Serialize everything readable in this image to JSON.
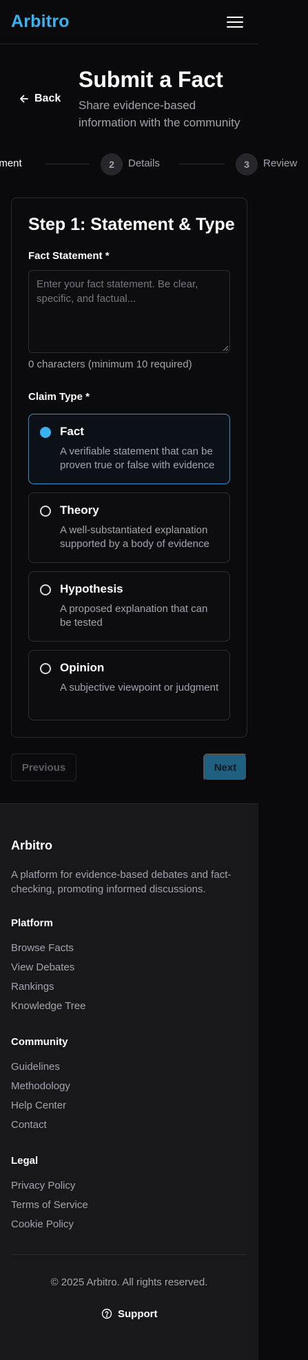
{
  "header": {
    "brand": "Arbitro",
    "menu_icon": "hamburger-menu-icon"
  },
  "page": {
    "back_label": "Back",
    "title": "Submit a Fact",
    "subtitle": "Share evidence-based information with the community"
  },
  "stepper": {
    "steps": [
      {
        "label": "Statement",
        "visible_label": "ement",
        "state": "current"
      },
      {
        "number": "2",
        "label": "Details",
        "state": "upcoming"
      },
      {
        "number": "3",
        "label": "Review",
        "state": "upcoming"
      }
    ]
  },
  "form": {
    "card_title": "Step 1: Statement & Type",
    "statement_label": "Fact Statement *",
    "statement_value": "",
    "statement_placeholder": "Enter your fact statement. Be clear, specific, and factual...",
    "char_count": "0 characters (minimum 10 required)",
    "claim_type_label": "Claim Type *",
    "selected_option": "Fact",
    "options": [
      {
        "title": "Fact",
        "description": "A verifiable statement that can be proven true or false with evidence"
      },
      {
        "title": "Theory",
        "description": "A well-substantiated explanation supported by a body of evidence"
      },
      {
        "title": "Hypothesis",
        "description": "A proposed explanation that can be tested"
      },
      {
        "title": "Opinion",
        "description": "A subjective viewpoint or judgment"
      }
    ]
  },
  "nav": {
    "previous_label": "Previous",
    "next_label": "Next"
  },
  "footer": {
    "brand": "Arbitro",
    "description": "A platform for evidence-based debates and fact-checking, promoting informed discussions.",
    "sections": [
      {
        "heading": "Platform",
        "links": [
          "Browse Facts",
          "View Debates",
          "Rankings",
          "Knowledge Tree"
        ]
      },
      {
        "heading": "Community",
        "links": [
          "Guidelines",
          "Methodology",
          "Help Center",
          "Contact"
        ]
      },
      {
        "heading": "Legal",
        "links": [
          "Privacy Policy",
          "Terms of Service",
          "Cookie Policy"
        ]
      }
    ],
    "copyright": "© 2025 Arbitro. All rights reserved.",
    "support_label": "Support"
  },
  "colors": {
    "accent": "#3ab2ef",
    "background": "#0a0a0c",
    "footer_background": "#18181b",
    "muted_text": "#a3a3ad",
    "next_button": "#1f5f80"
  }
}
